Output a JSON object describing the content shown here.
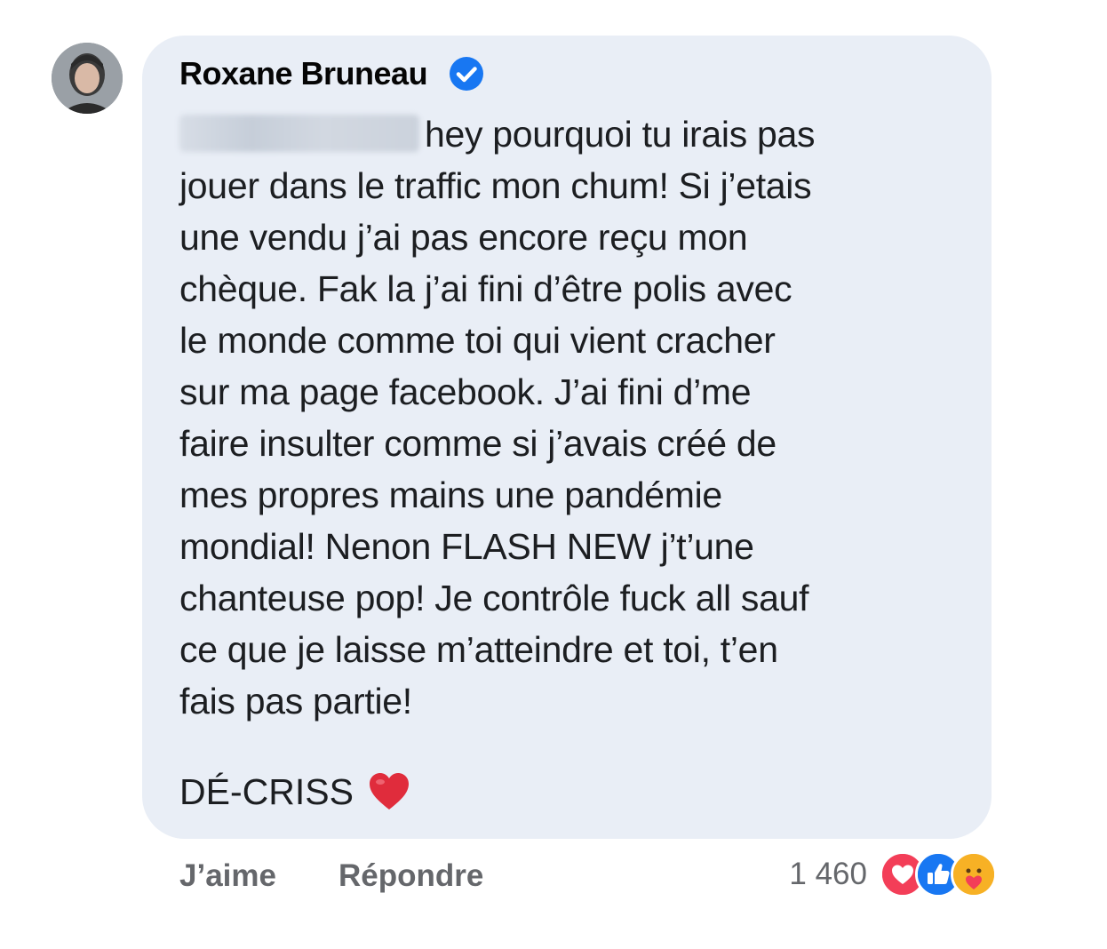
{
  "comment": {
    "author": {
      "name": "Roxane Bruneau",
      "verified_icon": "verified-badge-icon",
      "accent_color": "#1877f2"
    },
    "body_lines": [
      "hey pourquoi tu irais pas",
      "jouer dans le traffic mon chum! Si j’etais",
      "une vendu j’ai pas encore reçu mon",
      "chèque. Fak la j’ai fini d’être polis avec",
      "le monde comme toi qui vient cracher",
      "sur ma page facebook. J’ai fini d’me",
      "faire insulter comme si j’avais créé de",
      "mes propres mains une pandémie",
      "mondial! Nenon FLASH NEW j’t’une",
      "chanteuse pop! Je contrôle fuck all sauf",
      "ce que je laisse m’atteindre et toi, t’en",
      "fais pas partie!"
    ],
    "signoff": "DÉ-CRISS",
    "signoff_icon": "red-heart-icon",
    "bubble_color": "#e9eef6"
  },
  "actions": {
    "like_label": "J’aime",
    "reply_label": "Répondre"
  },
  "reactions": {
    "count": "1 460",
    "icons": [
      "love-reaction-icon",
      "like-reaction-icon",
      "care-reaction-icon"
    ],
    "colors": {
      "love": "#f33e58",
      "like": "#1877f2",
      "care": "#f7b125"
    }
  }
}
